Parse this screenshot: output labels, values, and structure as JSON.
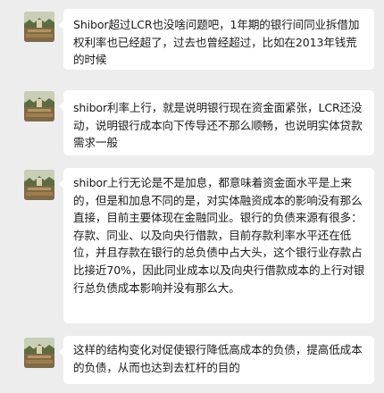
{
  "chat": {
    "messages": [
      {
        "avatar_icon": "user-avatar-icon",
        "text": "Shibor超过LCR也没啥问题吧，1年期的银行间同业拆借加权利率也已经超了，过去也曾经超过，比如在2013年钱荒的时候"
      },
      {
        "avatar_icon": "user-avatar-icon",
        "text": "shibor利率上行，就是说明银行现在资金面紧张，LCR还没动，说明银行成本向下传导还不那么顺畅，也说明实体贷款需求一般"
      },
      {
        "avatar_icon": "user-avatar-icon",
        "text": "shibor上行无论是不是加息，都意味着资金面水平是上来的，但是和加息不同的是，对实体融资成本的影响没有那么直接，目前主要体现在金融同业。银行的负债来源有很多：存款、同业、以及向央行借款，目前存款利率水平还在低位，并且存款在银行的总负债中占大头，这个银行业存款占比接近70%，因此同业成本以及向央行借款成本的上行对银行总负债成本影响并没有那么大。"
      },
      {
        "avatar_icon": "user-avatar-icon",
        "text": "这样的结构变化对促使银行降低高成本的负债，提高低成本的负债，从而也达到去杠杆的目的"
      }
    ]
  },
  "colors": {
    "background": "#ededed",
    "bubble": "#ffffff",
    "text": "#1b1b1b"
  }
}
